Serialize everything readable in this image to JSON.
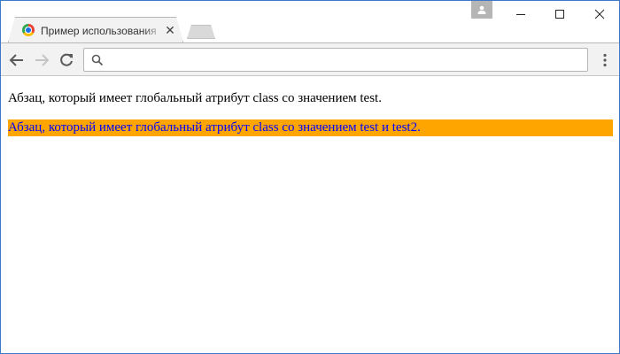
{
  "browser": {
    "tab": {
      "title": "Пример использования",
      "close_glyph": "✕"
    },
    "address_bar": {
      "value": "",
      "placeholder": ""
    },
    "menu_glyph": "⋮"
  },
  "page": {
    "paragraph1": "Абзац, который имеет глобальный атрибут class со значением test.",
    "paragraph2": "Абзац, который имеет глобальный атрибут class со значением test и test2.",
    "paragraph2_background": "#ffa500",
    "paragraph2_color": "#0000ff"
  },
  "colors": {
    "window_border": "#3c78c8",
    "toolbar": "#f2f2f2"
  }
}
